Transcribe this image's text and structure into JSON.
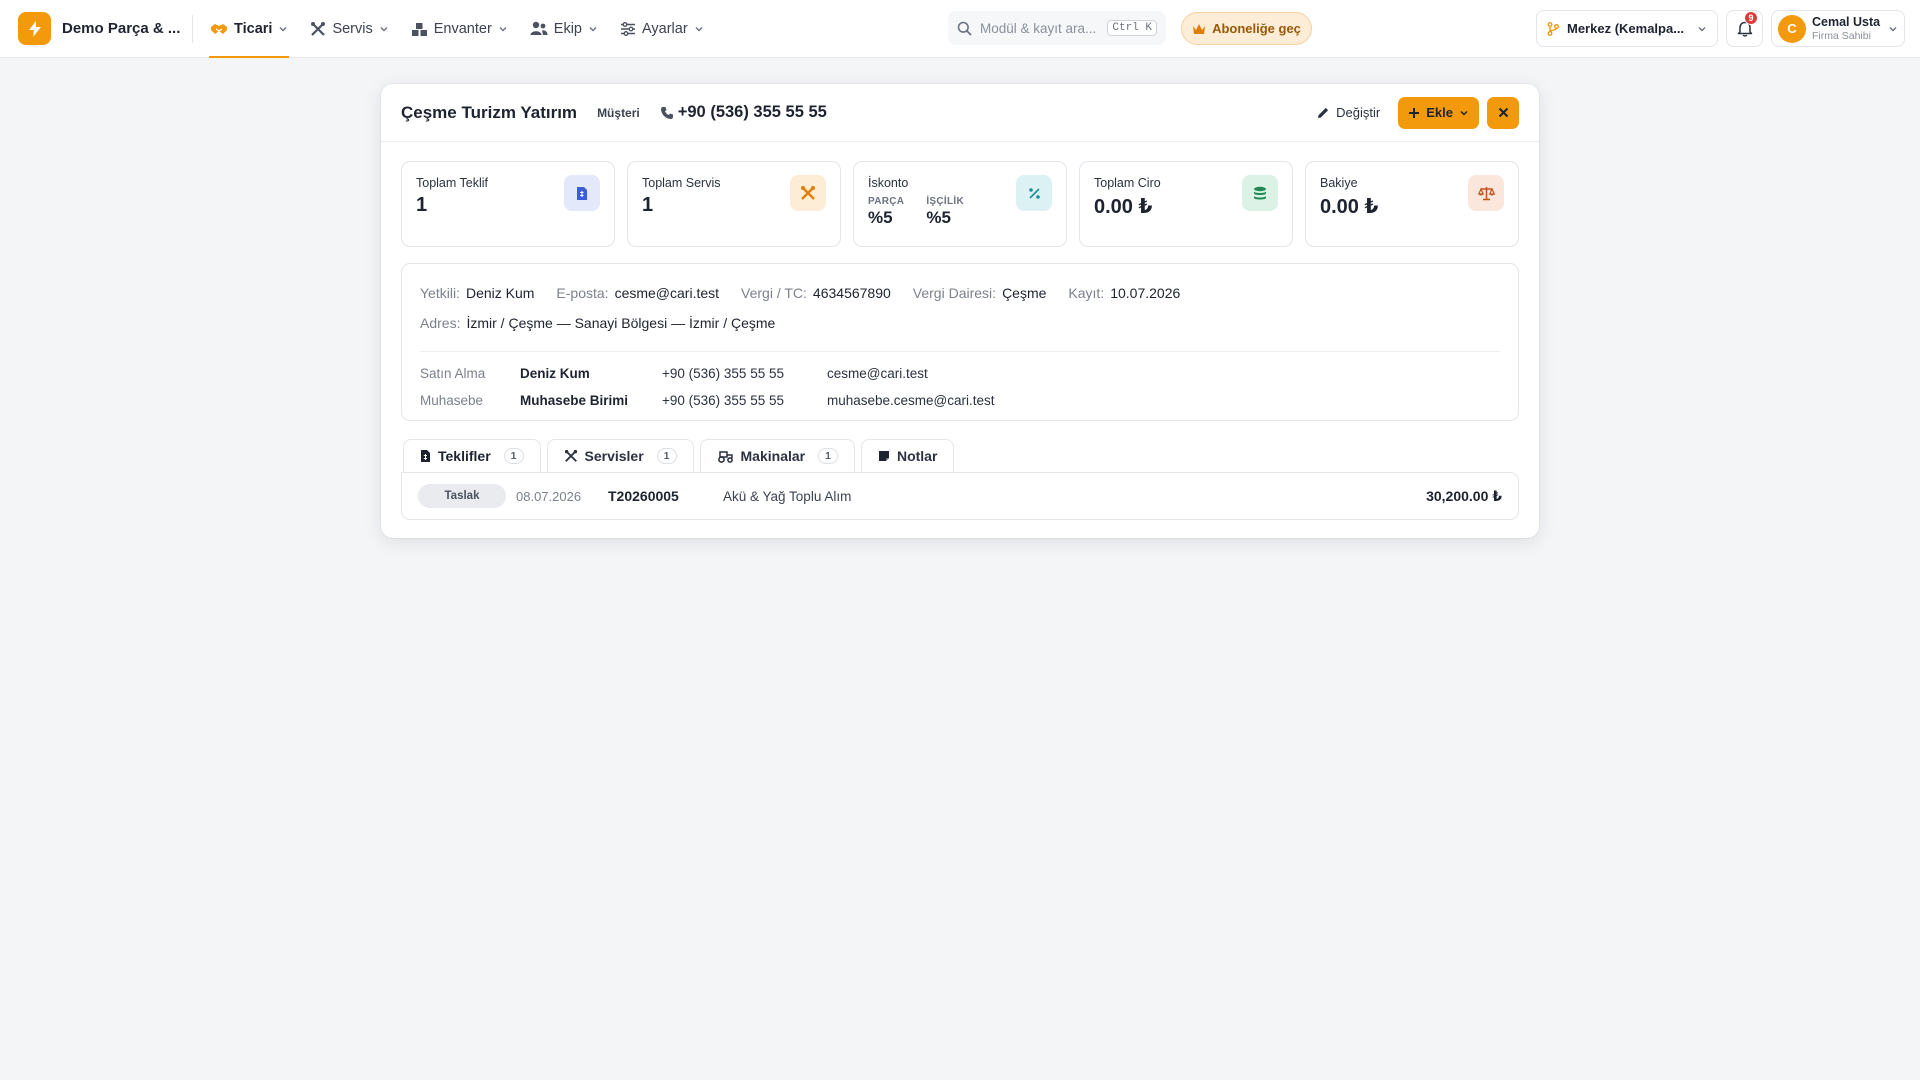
{
  "app": {
    "brand_name": "Demo Parça & ...",
    "brand_color": "#f29a0c"
  },
  "nav": [
    {
      "label": "Ticari",
      "active": true
    },
    {
      "label": "Servis",
      "active": false
    },
    {
      "label": "Envanter",
      "active": false
    },
    {
      "label": "Ekip",
      "active": false
    },
    {
      "label": "Ayarlar",
      "active": false
    }
  ],
  "search": {
    "placeholder": "Modül & kayıt ara...",
    "shortcut": "Ctrl K"
  },
  "upgrade_label": "Aboneliğe geç",
  "branch": {
    "label": "Merkez (Kemalpa..."
  },
  "notifications": {
    "count": "9"
  },
  "user": {
    "initial": "C",
    "name": "Cemal Usta",
    "role": "Firma Sahibi"
  },
  "customer": {
    "name": "Çeşme Turizm Yatırım",
    "type": "Müşteri",
    "phone": "+90 (536) 355 55 55",
    "edit_label": "Değiştir",
    "add_label": "Ekle"
  },
  "stats": {
    "quotes": {
      "label": "Toplam Teklif",
      "value": "1"
    },
    "services": {
      "label": "Toplam Servis",
      "value": "1"
    },
    "discount": {
      "label": "İskonto",
      "parts_label": "PARÇA",
      "parts_value": "%5",
      "labor_label": "İŞÇİLİK",
      "labor_value": "%5"
    },
    "turnover": {
      "label": "Toplam Ciro",
      "value": "0.00 ₺"
    },
    "balance": {
      "label": "Bakiye",
      "value": "0.00 ₺"
    }
  },
  "info": {
    "contact_person": {
      "label": "Yetkili:",
      "value": "Deniz Kum"
    },
    "email": {
      "label": "E-posta:",
      "value": "cesme@cari.test"
    },
    "tax_id": {
      "label": "Vergi / TC:",
      "value": "4634567890"
    },
    "tax_office": {
      "label": "Vergi Dairesi:",
      "value": "Çeşme"
    },
    "registered": {
      "label": "Kayıt:",
      "value": "10.07.2026"
    },
    "address": {
      "label": "Adres:",
      "value": "İzmir / Çeşme — Sanayi Bölgesi — İzmir / Çeşme"
    }
  },
  "contacts": [
    {
      "role": "Satın Alma",
      "name": "Deniz Kum",
      "phone": "+90 (536) 355 55 55",
      "email": "cesme@cari.test"
    },
    {
      "role": "Muhasebe",
      "name": "Muhasebe Birimi",
      "phone": "+90 (536) 355 55 55",
      "email": "muhasebe.cesme@cari.test"
    }
  ],
  "tabs": [
    {
      "label": "Teklifler",
      "count": "1",
      "active": true
    },
    {
      "label": "Servisler",
      "count": "1",
      "active": false
    },
    {
      "label": "Makinalar",
      "count": "1",
      "active": false
    },
    {
      "label": "Notlar",
      "count": "",
      "active": false
    }
  ],
  "quotes": [
    {
      "status": "Taslak",
      "date": "08.07.2026",
      "number": "T20260005",
      "title": "Akü & Yağ Toplu Alım",
      "amount": "30,200.00 ₺"
    }
  ]
}
